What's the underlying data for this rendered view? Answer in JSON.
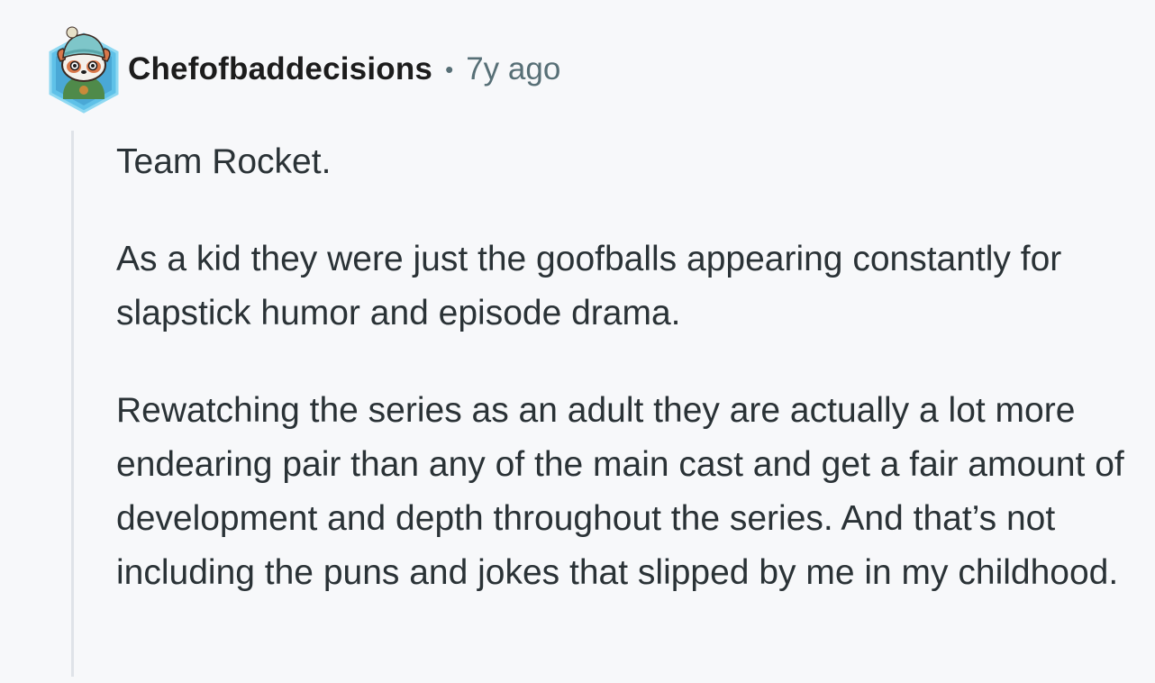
{
  "comment": {
    "author": "Chefofbaddecisions",
    "separator": "•",
    "timestamp": "7y ago",
    "avatar_icon": "red-panda-avatar-icon",
    "paragraphs": [
      "Team Rocket.",
      "As a kid they were just the goofballs appearing constantly for slapstick humor and episode drama.",
      "Rewatching the series as an adult they are actually a lot more endearing pair than any of the main cast and get a fair amount of development and depth throughout the series. And that’s not including the puns and jokes that slipped by me in my childhood."
    ]
  },
  "colors": {
    "background": "#f7f8fa",
    "text": "#2a3236",
    "meta": "#576f76",
    "thread_line": "#dfe3e8",
    "avatar_hex": "#5fc1e8"
  }
}
